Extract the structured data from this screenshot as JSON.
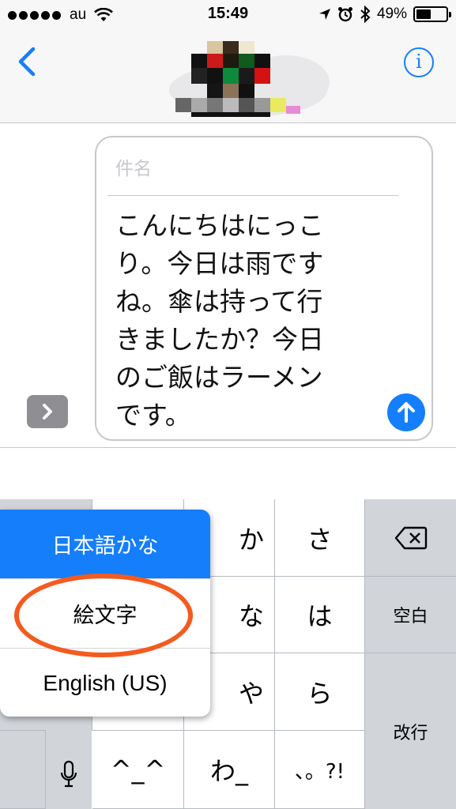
{
  "status_bar": {
    "carrier": "au",
    "time": "15:49",
    "battery_percent": "49%",
    "battery_level": 0.49,
    "signal_dots": 5
  },
  "nav": {
    "back_icon": "chevron-left-icon",
    "info_icon": "info-circle-icon",
    "info_glyph": "i",
    "avatar": "pixelated-contact-avatar"
  },
  "compose": {
    "subject_placeholder": "件名",
    "message": "こんにちはにっこ\nり。今日は雨です\nね。傘は持って行\nきましたか？今日\nのご飯はラーメン\nです。",
    "expand_icon": "chevron-right-icon",
    "send_icon": "arrow-up-icon"
  },
  "colors": {
    "accent": "#157efb",
    "highlight": "#f55a1e",
    "key_dark": "#d1d4d9"
  },
  "keyboard": {
    "keys": {
      "ka": "か",
      "sa": "さ",
      "na": "な",
      "ha": "は",
      "ya": "や",
      "ra": "ら",
      "emoticon": "^_^",
      "wa": "わ_",
      "punct": "、。?!",
      "space": "空白",
      "enter": "改行"
    },
    "backspace_icon": "backspace-icon",
    "mic_icon": "microphone-icon"
  },
  "language_menu": {
    "items": [
      "日本語かな",
      "絵文字",
      "English (US)"
    ],
    "selected_index": 0
  }
}
